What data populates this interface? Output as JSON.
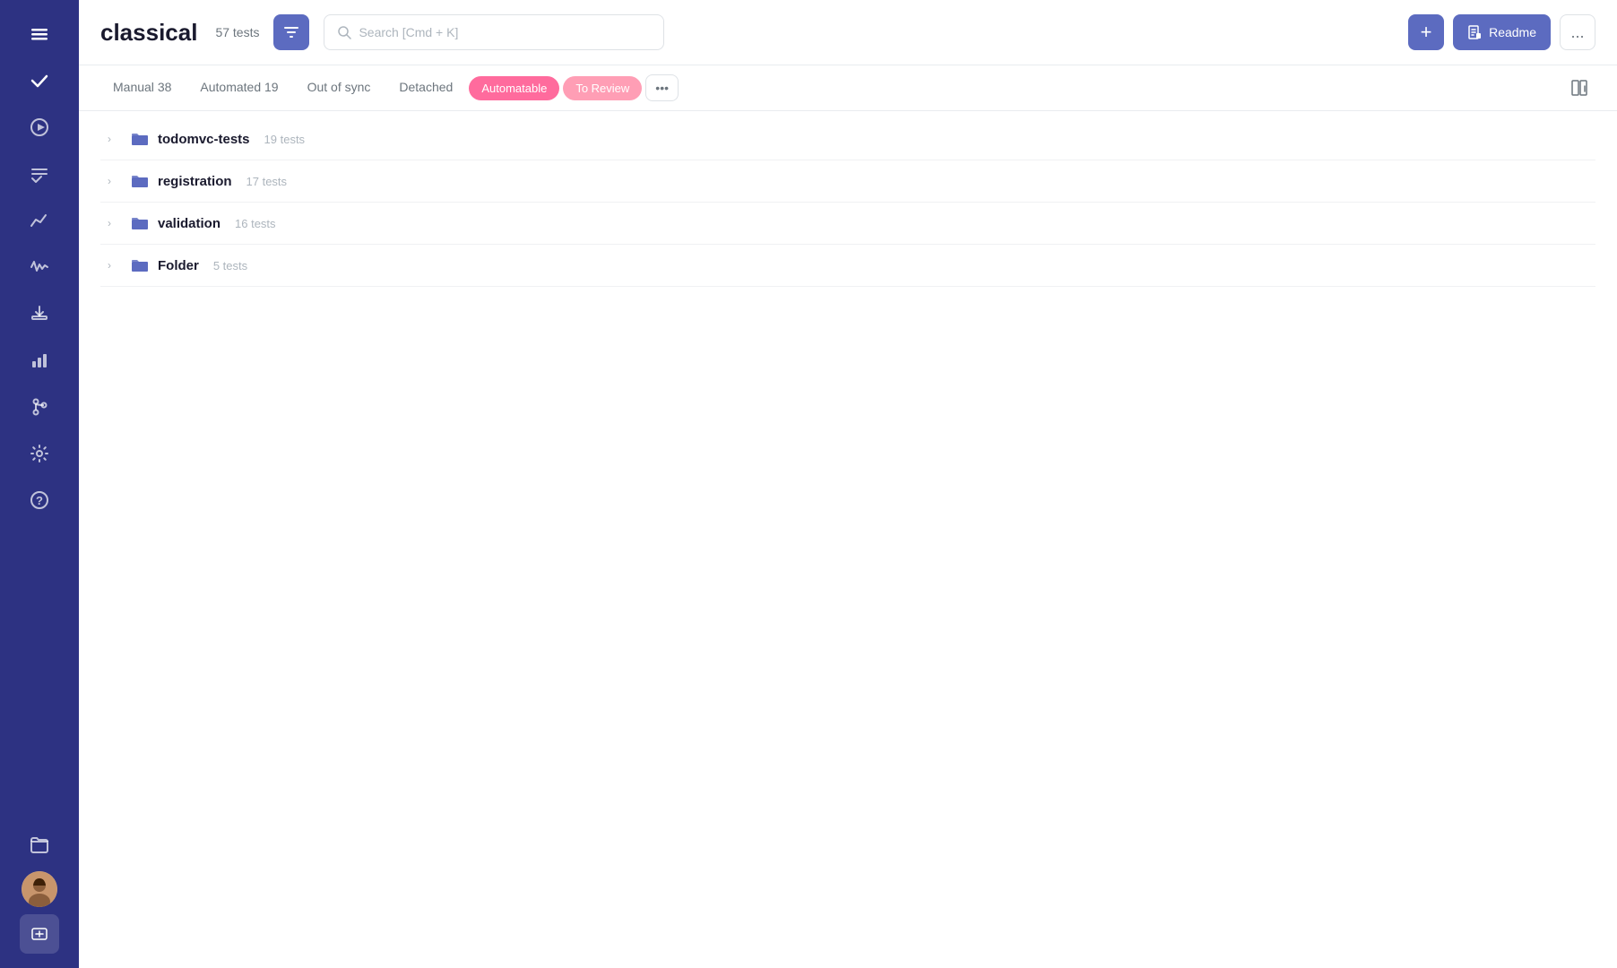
{
  "sidebar": {
    "icons": [
      {
        "name": "hamburger-icon",
        "symbol": "☰"
      },
      {
        "name": "check-icon",
        "symbol": "✓"
      },
      {
        "name": "play-icon",
        "symbol": "▶"
      },
      {
        "name": "list-check-icon",
        "symbol": "≡✓"
      },
      {
        "name": "chart-line-icon",
        "symbol": "📈"
      },
      {
        "name": "activity-icon",
        "symbol": "〜"
      },
      {
        "name": "import-icon",
        "symbol": "⬑"
      },
      {
        "name": "bar-chart-icon",
        "symbol": "▦"
      },
      {
        "name": "git-icon",
        "symbol": "⌥"
      },
      {
        "name": "settings-icon",
        "symbol": "⚙"
      },
      {
        "name": "help-icon",
        "symbol": "?"
      },
      {
        "name": "folder-icon",
        "symbol": "❑"
      }
    ]
  },
  "header": {
    "app_title": "classical",
    "test_count_label": "57 tests",
    "filter_label": "filter",
    "search_placeholder": "Search [Cmd + K]",
    "add_label": "+",
    "readme_label": "Readme",
    "more_label": "..."
  },
  "tabs": [
    {
      "id": "manual",
      "label": "Manual",
      "count": "38",
      "active": false
    },
    {
      "id": "automated",
      "label": "Automated",
      "count": "19",
      "active": false
    },
    {
      "id": "out-of-sync",
      "label": "Out of sync",
      "count": "",
      "active": false
    },
    {
      "id": "detached",
      "label": "Detached",
      "count": "",
      "active": false
    }
  ],
  "pill_tabs": [
    {
      "id": "automatable",
      "label": "Automatable",
      "style": "automatable"
    },
    {
      "id": "to-review",
      "label": "To Review",
      "style": "to-review"
    }
  ],
  "folders": [
    {
      "name": "todomvc-tests",
      "count": "19 tests"
    },
    {
      "name": "registration",
      "count": "17 tests"
    },
    {
      "name": "validation",
      "count": "16 tests"
    },
    {
      "name": "Folder",
      "count": "5 tests"
    }
  ],
  "colors": {
    "sidebar_bg": "#2d3282",
    "accent": "#5c6bc0",
    "automatable_bg": "#ff6b9d",
    "to_review_bg": "#ff9eb5"
  }
}
